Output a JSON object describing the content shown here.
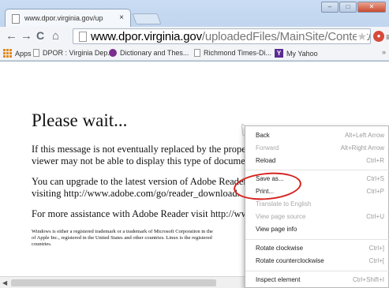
{
  "tab": {
    "title": "www.dpor.virginia.gov/up",
    "close": "×"
  },
  "window": {
    "minimize": "‒",
    "maximize": "□",
    "close": "✕"
  },
  "toolbar": {
    "back": "←",
    "forward": "→",
    "reload": "C",
    "home": "⌂",
    "url_host": "www.dpor.virginia.gov",
    "url_path": "/uploadedFiles/MainSite/Content/Boards/",
    "star": "★",
    "menu": "≡"
  },
  "bookmarks": [
    {
      "label": "Apps",
      "icon": "apps-icon"
    },
    {
      "label": "DPOR : Virginia Dep...",
      "icon": "page-icon"
    },
    {
      "label": "Dictionary and Thes...",
      "icon": "dictionary-icon"
    },
    {
      "label": "Richmond Times-Di...",
      "icon": "page-icon"
    },
    {
      "label": "My Yahoo",
      "icon": "yahoo-icon"
    }
  ],
  "bookmarks_more": "»",
  "page": {
    "title": "Please wait...",
    "p1_line1": "If this message is not eventually replaced by the proper con",
    "p1_line2": "viewer may not be able to display this type of document.",
    "p2_line1": "You can upgrade to the latest version of Adobe Reader for",
    "p2_line2": "visiting  http://www.adobe.com/go/reader_download.",
    "p3_line1": "For more assistance with Adobe Reader visit  http://www.a",
    "fine_line1": "Windows is either a registered trademark or a trademark of Microsoft Corporation in the",
    "fine_line2": "of Apple Inc., registered in the United States and other countries. Linux is the registered",
    "fine_line3": "countries."
  },
  "context_menu": {
    "items": [
      {
        "label": "Back",
        "shortcut": "Alt+Left Arrow",
        "disabled": false
      },
      {
        "label": "Forward",
        "shortcut": "Alt+Right Arrow",
        "disabled": true
      },
      {
        "label": "Reload",
        "shortcut": "Ctrl+R",
        "disabled": false
      },
      {
        "label": "Save as...",
        "shortcut": "Ctrl+S",
        "disabled": false
      },
      {
        "label": "Print...",
        "shortcut": "Ctrl+P",
        "disabled": false
      },
      {
        "label": "Translate to English",
        "shortcut": "",
        "disabled": true
      },
      {
        "label": "View page source",
        "shortcut": "Ctrl+U",
        "disabled": true
      },
      {
        "label": "View page info",
        "shortcut": "",
        "disabled": false
      },
      {
        "label": "Rotate clockwise",
        "shortcut": "Ctrl+]",
        "disabled": false
      },
      {
        "label": "Rotate counterclockwise",
        "shortcut": "Ctrl+[",
        "disabled": false
      },
      {
        "label": "Inspect element",
        "shortcut": "Ctrl+Shift+I",
        "disabled": false
      }
    ]
  },
  "colors": {
    "highlight_ring": "#d62420",
    "chrome": "#c9dcf3"
  }
}
